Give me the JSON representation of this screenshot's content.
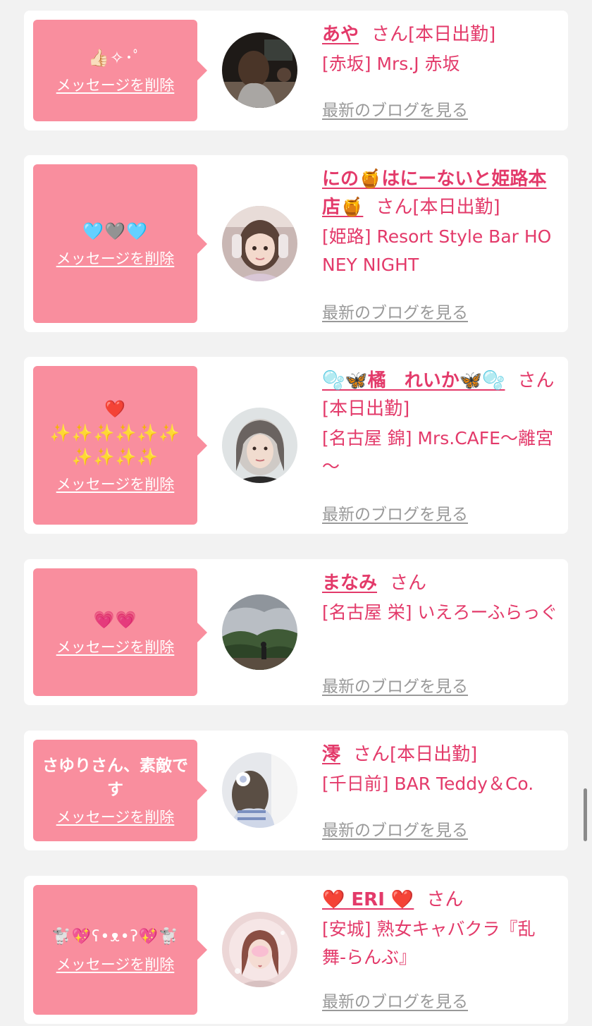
{
  "colors": {
    "page_bg": "#f2f2f2",
    "card_bg": "#ffffff",
    "bubble_bg": "#f98e9e",
    "name_text": "#e33a6a",
    "blog_link": "#999999"
  },
  "cards": [
    {
      "message": "👍🏻✧･ﾟ",
      "message_is_emoji": true,
      "delete_label": "メッセージを削除",
      "avatar_icon": "avatar-photo-woman-back-view",
      "name": "あや",
      "honorific": "さん",
      "status": "[本日出勤]",
      "shop": "[赤坂] Mrs.J 赤坂",
      "blog_label": "最新のブログを見る"
    },
    {
      "message": "🩵🩶🩵",
      "message_is_emoji": true,
      "delete_label": "メッセージを削除",
      "avatar_icon": "avatar-photo-woman-headphones",
      "name": "にの🍯はにーないと姫路本店🍯",
      "honorific": "さん",
      "status": "[本日出勤]",
      "shop": "[姫路] Resort Style Bar HONEY NIGHT",
      "blog_label": "最新のブログを見る"
    },
    {
      "message": "❤️\n✨✨✨✨✨✨\n✨✨✨✨",
      "message_is_emoji": true,
      "delete_label": "メッセージを削除",
      "avatar_icon": "avatar-photo-woman-silver-hair",
      "name": "🫧🦋橘　れいか🦋🫧",
      "honorific": "さん",
      "status": "[本日出勤]",
      "shop": "[名古屋 錦] Mrs.CAFE～離宮～",
      "blog_label": "最新のブログを見る"
    },
    {
      "message": "💗💗",
      "message_is_emoji": true,
      "delete_label": "メッセージを削除",
      "avatar_icon": "avatar-photo-landscape-mountains",
      "name": "まなみ",
      "honorific": "さん",
      "status": "",
      "shop": "[名古屋 栄] いえろーふらっぐ",
      "blog_label": "最新のブログを見る"
    },
    {
      "message": "さゆりさん、素敵です",
      "message_is_emoji": false,
      "delete_label": "メッセージを削除",
      "avatar_icon": "avatar-photo-woman-mirror-selfie",
      "name": "澪",
      "honorific": "さん",
      "status": "[本日出勤]",
      "shop": "[千日前] BAR Teddy＆Co.",
      "blog_label": "最新のブログを見る"
    },
    {
      "message": "🐩💖ʕ•ᴥ•ʔ💖🐩",
      "message_is_emoji": true,
      "delete_label": "メッセージを削除",
      "avatar_icon": "avatar-photo-woman-pink-frame",
      "name": "❤️ ERI ❤️",
      "honorific": "さん",
      "status": "",
      "shop": "[安城] 熟女キャバクラ『乱舞-らんぶ』",
      "blog_label": "最新のブログを見る"
    }
  ]
}
